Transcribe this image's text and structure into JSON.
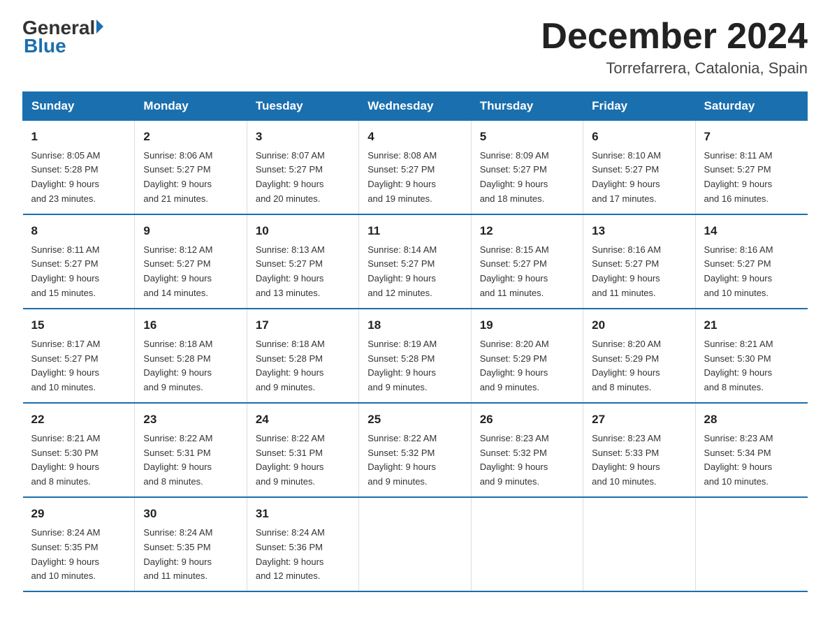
{
  "header": {
    "logo_general": "General",
    "logo_triangle": "",
    "logo_blue": "Blue",
    "main_title": "December 2024",
    "subtitle": "Torrefarrera, Catalonia, Spain"
  },
  "days_of_week": [
    "Sunday",
    "Monday",
    "Tuesday",
    "Wednesday",
    "Thursday",
    "Friday",
    "Saturday"
  ],
  "weeks": [
    [
      {
        "day": "1",
        "info": "Sunrise: 8:05 AM\nSunset: 5:28 PM\nDaylight: 9 hours\nand 23 minutes."
      },
      {
        "day": "2",
        "info": "Sunrise: 8:06 AM\nSunset: 5:27 PM\nDaylight: 9 hours\nand 21 minutes."
      },
      {
        "day": "3",
        "info": "Sunrise: 8:07 AM\nSunset: 5:27 PM\nDaylight: 9 hours\nand 20 minutes."
      },
      {
        "day": "4",
        "info": "Sunrise: 8:08 AM\nSunset: 5:27 PM\nDaylight: 9 hours\nand 19 minutes."
      },
      {
        "day": "5",
        "info": "Sunrise: 8:09 AM\nSunset: 5:27 PM\nDaylight: 9 hours\nand 18 minutes."
      },
      {
        "day": "6",
        "info": "Sunrise: 8:10 AM\nSunset: 5:27 PM\nDaylight: 9 hours\nand 17 minutes."
      },
      {
        "day": "7",
        "info": "Sunrise: 8:11 AM\nSunset: 5:27 PM\nDaylight: 9 hours\nand 16 minutes."
      }
    ],
    [
      {
        "day": "8",
        "info": "Sunrise: 8:11 AM\nSunset: 5:27 PM\nDaylight: 9 hours\nand 15 minutes."
      },
      {
        "day": "9",
        "info": "Sunrise: 8:12 AM\nSunset: 5:27 PM\nDaylight: 9 hours\nand 14 minutes."
      },
      {
        "day": "10",
        "info": "Sunrise: 8:13 AM\nSunset: 5:27 PM\nDaylight: 9 hours\nand 13 minutes."
      },
      {
        "day": "11",
        "info": "Sunrise: 8:14 AM\nSunset: 5:27 PM\nDaylight: 9 hours\nand 12 minutes."
      },
      {
        "day": "12",
        "info": "Sunrise: 8:15 AM\nSunset: 5:27 PM\nDaylight: 9 hours\nand 11 minutes."
      },
      {
        "day": "13",
        "info": "Sunrise: 8:16 AM\nSunset: 5:27 PM\nDaylight: 9 hours\nand 11 minutes."
      },
      {
        "day": "14",
        "info": "Sunrise: 8:16 AM\nSunset: 5:27 PM\nDaylight: 9 hours\nand 10 minutes."
      }
    ],
    [
      {
        "day": "15",
        "info": "Sunrise: 8:17 AM\nSunset: 5:27 PM\nDaylight: 9 hours\nand 10 minutes."
      },
      {
        "day": "16",
        "info": "Sunrise: 8:18 AM\nSunset: 5:28 PM\nDaylight: 9 hours\nand 9 minutes."
      },
      {
        "day": "17",
        "info": "Sunrise: 8:18 AM\nSunset: 5:28 PM\nDaylight: 9 hours\nand 9 minutes."
      },
      {
        "day": "18",
        "info": "Sunrise: 8:19 AM\nSunset: 5:28 PM\nDaylight: 9 hours\nand 9 minutes."
      },
      {
        "day": "19",
        "info": "Sunrise: 8:20 AM\nSunset: 5:29 PM\nDaylight: 9 hours\nand 9 minutes."
      },
      {
        "day": "20",
        "info": "Sunrise: 8:20 AM\nSunset: 5:29 PM\nDaylight: 9 hours\nand 8 minutes."
      },
      {
        "day": "21",
        "info": "Sunrise: 8:21 AM\nSunset: 5:30 PM\nDaylight: 9 hours\nand 8 minutes."
      }
    ],
    [
      {
        "day": "22",
        "info": "Sunrise: 8:21 AM\nSunset: 5:30 PM\nDaylight: 9 hours\nand 8 minutes."
      },
      {
        "day": "23",
        "info": "Sunrise: 8:22 AM\nSunset: 5:31 PM\nDaylight: 9 hours\nand 8 minutes."
      },
      {
        "day": "24",
        "info": "Sunrise: 8:22 AM\nSunset: 5:31 PM\nDaylight: 9 hours\nand 9 minutes."
      },
      {
        "day": "25",
        "info": "Sunrise: 8:22 AM\nSunset: 5:32 PM\nDaylight: 9 hours\nand 9 minutes."
      },
      {
        "day": "26",
        "info": "Sunrise: 8:23 AM\nSunset: 5:32 PM\nDaylight: 9 hours\nand 9 minutes."
      },
      {
        "day": "27",
        "info": "Sunrise: 8:23 AM\nSunset: 5:33 PM\nDaylight: 9 hours\nand 10 minutes."
      },
      {
        "day": "28",
        "info": "Sunrise: 8:23 AM\nSunset: 5:34 PM\nDaylight: 9 hours\nand 10 minutes."
      }
    ],
    [
      {
        "day": "29",
        "info": "Sunrise: 8:24 AM\nSunset: 5:35 PM\nDaylight: 9 hours\nand 10 minutes."
      },
      {
        "day": "30",
        "info": "Sunrise: 8:24 AM\nSunset: 5:35 PM\nDaylight: 9 hours\nand 11 minutes."
      },
      {
        "day": "31",
        "info": "Sunrise: 8:24 AM\nSunset: 5:36 PM\nDaylight: 9 hours\nand 12 minutes."
      },
      {
        "day": "",
        "info": ""
      },
      {
        "day": "",
        "info": ""
      },
      {
        "day": "",
        "info": ""
      },
      {
        "day": "",
        "info": ""
      }
    ]
  ]
}
